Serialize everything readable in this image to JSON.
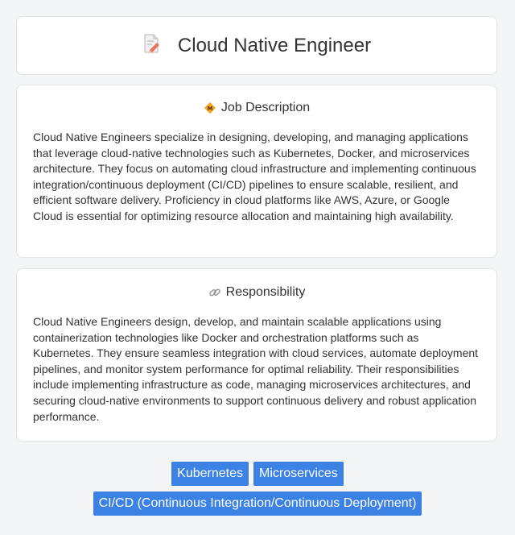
{
  "header": {
    "title": "Cloud Native Engineer",
    "icon": "document-pencil-icon"
  },
  "job_description": {
    "heading": "Job Description",
    "icon": "badge-icon",
    "body": "Cloud Native Engineers specialize in designing, developing, and managing applications that leverage cloud-native technologies such as Kubernetes, Docker, and microservices architecture. They focus on automating cloud infrastructure and implementing continuous integration/continuous deployment (CI/CD) pipelines to ensure scalable, resilient, and efficient software delivery. Proficiency in cloud platforms like AWS, Azure, or Google Cloud is essential for optimizing resource allocation and maintaining high availability."
  },
  "responsibility": {
    "heading": "Responsibility",
    "icon": "link-icon",
    "body": "Cloud Native Engineers design, develop, and maintain scalable applications using containerization technologies like Docker and orchestration platforms such as Kubernetes. They ensure seamless integration with cloud services, automate deployment pipelines, and monitor system performance for optimal reliability. Their responsibilities include implementing infrastructure as code, managing microservices architectures, and securing cloud-native environments to support continuous delivery and robust application performance."
  },
  "tags": [
    "Kubernetes",
    "Microservices",
    "CI/CD (Continuous Integration/Continuous Deployment)"
  ],
  "colors": {
    "tag_bg": "#3b82e4",
    "page_bg": "#f4f5f7",
    "card_bg": "#ffffff"
  }
}
